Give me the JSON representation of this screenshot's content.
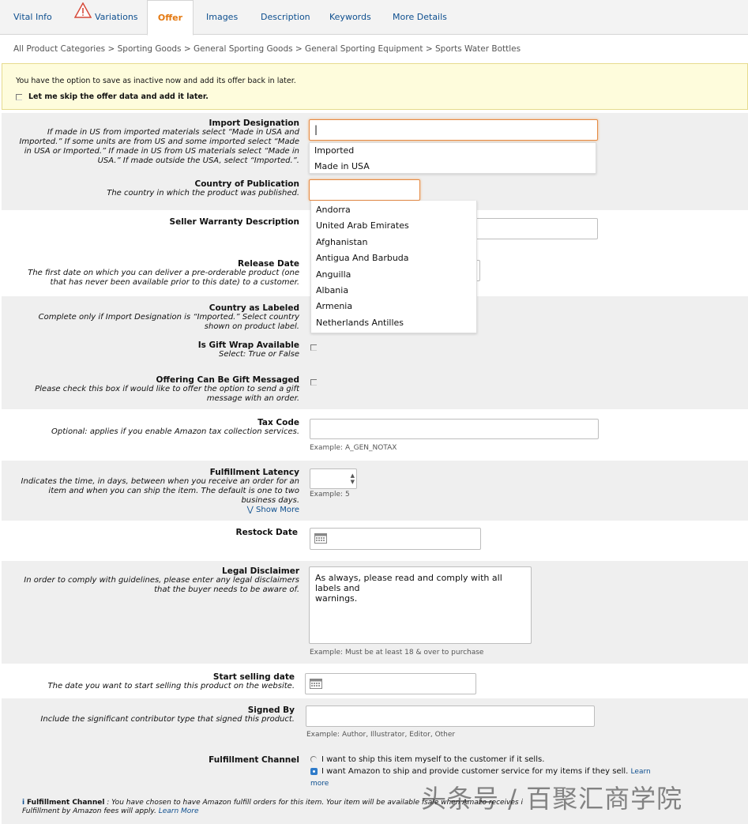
{
  "tabs": [
    "Vital Info",
    "Variations",
    "Offer",
    "Images",
    "Description",
    "Keywords",
    "More Details"
  ],
  "breadcrumb": "All Product Categories > Sporting Goods > General Sporting Goods > General Sporting Equipment > Sports Water Bottles",
  "notice": {
    "text": "You have the option to save as inactive now and add its offer back in later.",
    "skip_label": "Let me skip the offer data and add it later."
  },
  "fields": {
    "import_designation": {
      "title": "Import Designation",
      "desc": [
        "If made in US from imported materials select “Made in USA and",
        "Imported.” If some units are from US and some imported select “Made",
        "in USA or Imported.” If made in US from US materials select “Made in",
        "USA.” If made outside the USA, select “Imported.”."
      ],
      "value": "|",
      "options": [
        "Imported",
        "Made in USA"
      ]
    },
    "country_publication": {
      "title": "Country of Publication",
      "desc": [
        "The country in which the product was published."
      ],
      "options": [
        "Andorra",
        "United Arab Emirates",
        "Afghanistan",
        "Antigua And Barbuda",
        "Anguilla",
        "Albania",
        "Armenia",
        "Netherlands Antilles"
      ]
    },
    "seller_warranty": {
      "title": "Seller Warranty Description"
    },
    "release_date": {
      "title": "Release Date",
      "desc": [
        "The first date on which you can deliver a pre-orderable product (one",
        "that has never been available prior to this date) to a customer."
      ]
    },
    "country_labeled": {
      "title": "Country as Labeled",
      "desc": [
        "Complete only if Import Designation is “Imported.” Select country",
        "shown on product label."
      ]
    },
    "gift_wrap": {
      "title": "Is Gift Wrap Available",
      "desc": [
        "Select: True or False"
      ]
    },
    "gift_message": {
      "title": "Offering Can Be Gift Messaged",
      "desc": [
        "Please check this box if would like to offer the option to send a gift",
        "message with an order."
      ]
    },
    "tax_code": {
      "title": "Tax Code",
      "desc": [
        "Optional: applies if you enable Amazon tax collection services."
      ],
      "example": "Example:   A_GEN_NOTAX"
    },
    "fulfillment_latency": {
      "title": "Fulfillment Latency",
      "desc": [
        "Indicates the time, in days, between when you receive an order for an",
        "item and when you can ship the item.  The default is one to two",
        "business days."
      ],
      "show_more": "Show More",
      "example": "Example:   5"
    },
    "restock_date": {
      "title": "Restock Date"
    },
    "legal_disclaimer": {
      "title": "Legal Disclaimer",
      "desc": [
        "In order to comply with guidelines, please enter any legal disclaimers",
        "that the buyer needs to be aware of."
      ],
      "value": "As always, please read and comply with all labels and\nwarnings.",
      "example": "Example:   Must be at least 18 & over to purchase"
    },
    "start_selling": {
      "title": "Start selling date",
      "desc": [
        "The date you want to start selling this product on the website."
      ]
    },
    "signed_by": {
      "title": "Signed By",
      "desc": [
        "Include the significant contributor type that signed this product."
      ],
      "example": "Example:   Author, Illustrator, Editor, Other"
    },
    "fulfillment_channel": {
      "title": "Fulfillment Channel",
      "option1": "I want to ship this item myself to the customer if it sells.",
      "option2": "I want Amazon to ship and provide customer service for my items if they sell.",
      "learn_more": "Learn",
      "learn_more2": "more",
      "info_title": "Fulfillment Channel",
      "info_text": " : You have chosen to have Amazon fulfill orders for this item. Your item will be available f",
      "info_text_b": "sale when Amazo",
      "info_text_c": " receives i",
      "info_line2": "Fulfillment by Amazon fees will apply.",
      "info_link": "Learn More"
    }
  },
  "watermark": "头条号 / 百聚汇商学院",
  "colors": {
    "accent": "#e47911",
    "link": "#0e4f8f",
    "notice_bg": "#fefcdc",
    "shade": "#efefef"
  }
}
